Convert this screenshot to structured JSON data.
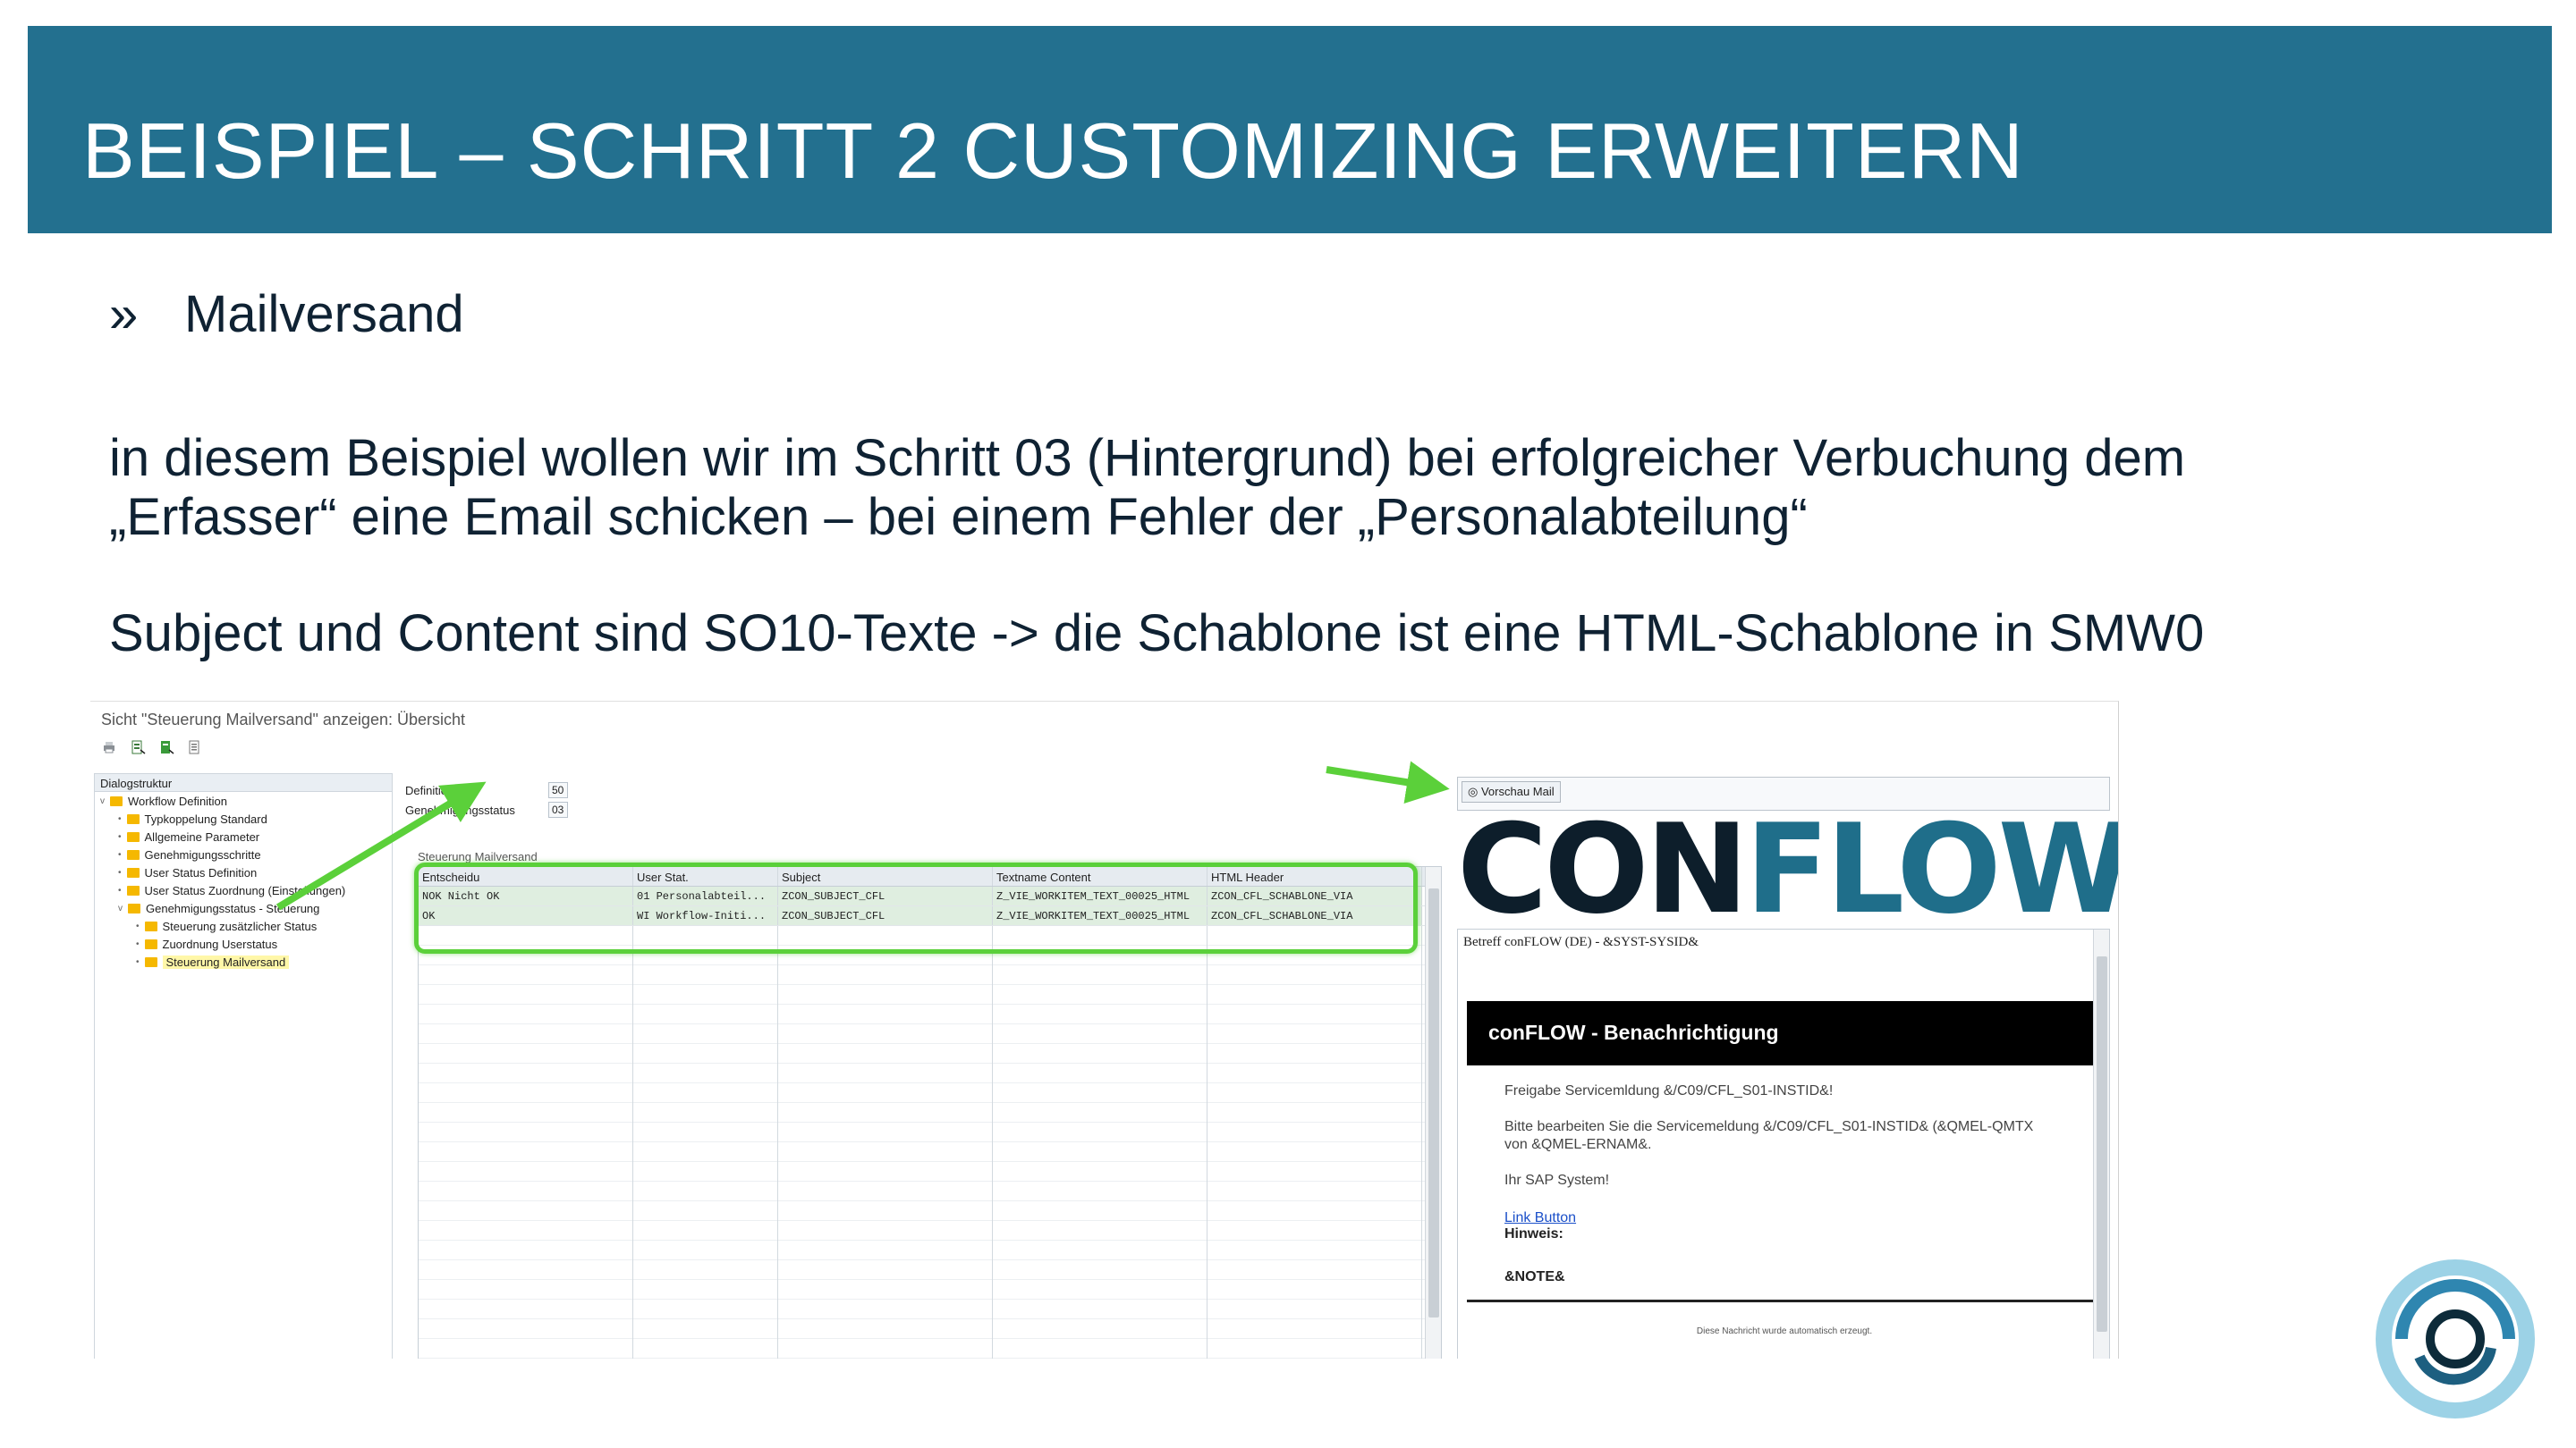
{
  "slide": {
    "title": "BEISPIEL – SCHRITT 2 CUSTOMIZING ERWEITERN",
    "bullet_mark": "»",
    "bullet": "Mailversand",
    "para1_line1": "in diesem Beispiel wollen wir im Schritt 03 (Hintergrund) bei erfolgreicher Verbuchung dem",
    "para1_line2": "„Erfasser“ eine Email schicken – bei einem Fehler der „Personalabteilung“",
    "para2": "Subject und Content sind SO10-Texte -> die Schablone ist eine HTML-Schablone in SMW0"
  },
  "sap": {
    "window_title": "Sicht \"Steuerung Mailversand\" anzeigen: Übersicht",
    "toolbar_icons": [
      "print-icon",
      "export-icon",
      "select-icon",
      "detail-icon"
    ],
    "tree": {
      "header": "Dialogstruktur",
      "items": [
        {
          "label": "Workflow Definition",
          "level": 0,
          "expand": "v"
        },
        {
          "label": "Typkoppelung Standard",
          "level": 1,
          "expand": "•"
        },
        {
          "label": "Allgemeine Parameter",
          "level": 1,
          "expand": "•"
        },
        {
          "label": "Genehmigungsschritte",
          "level": 1,
          "expand": "•"
        },
        {
          "label": "User Status Definition",
          "level": 1,
          "expand": "•"
        },
        {
          "label": "User Status Zuordnung (Einstellungen)",
          "level": 1,
          "expand": "•"
        },
        {
          "label": "Genehmigungsstatus - Steuerung",
          "level": 1,
          "expand": "v"
        },
        {
          "label": "Steuerung zusätzlicher Status",
          "level": 2,
          "expand": "•"
        },
        {
          "label": "Zuordnung Userstatus",
          "level": 2,
          "expand": "•"
        },
        {
          "label": "Steuerung Mailversand",
          "level": 2,
          "expand": "•",
          "selected": true
        }
      ]
    },
    "fields": {
      "definition_label": "Definition",
      "definition_value": "50",
      "genehm_label": "Genehmigungsstatus",
      "genehm_value": "03",
      "section_label": "Steuerung Mailversand"
    },
    "grid": {
      "columns": [
        "Entscheidu",
        "User Stat.",
        "Subject",
        "Textname Content",
        "HTML Header"
      ],
      "rows": [
        [
          "NOK Nicht OK",
          "01 Personalabteil...",
          "ZCON_SUBJECT_CFL",
          "Z_VIE_WORKITEM_TEXT_00025_HTML",
          "ZCON_CFL_SCHABLONE_VIA"
        ],
        [
          "OK",
          "WI Workflow-Initi...",
          "ZCON_SUBJECT_CFL",
          "Z_VIE_WORKITEM_TEXT_00025_HTML",
          "ZCON_CFL_SCHABLONE_VIA"
        ]
      ],
      "empty_rows": 22
    },
    "preview": {
      "button": "Vorschau Mail",
      "logo_con": "CON",
      "logo_flow": "FLOW",
      "mail_subject": "Betreff conFLOW (DE) - &SYST-SYSID&",
      "mail_header": "conFLOW - Benachrichtigung",
      "line1": "Freigabe Servicemldung &/C09/CFL_S01-INSTID&!",
      "line2a": "Bitte bearbeiten Sie die Servicemeldung &/C09/CFL_S01-INSTID& (&QMEL-QMTX",
      "line2b": "von &QMEL-ERNAM&.",
      "line3": "Ihr SAP System!",
      "link": "Link Button",
      "hint": "Hinweis:",
      "note": "&NOTE&",
      "footer": "Diese Nachricht wurde automatisch erzeugt."
    }
  },
  "colors": {
    "banner": "#23708f",
    "highlight": "#5bd03a",
    "logo_dark": "#0d1e2b",
    "logo_teal": "#1f6e8a"
  }
}
